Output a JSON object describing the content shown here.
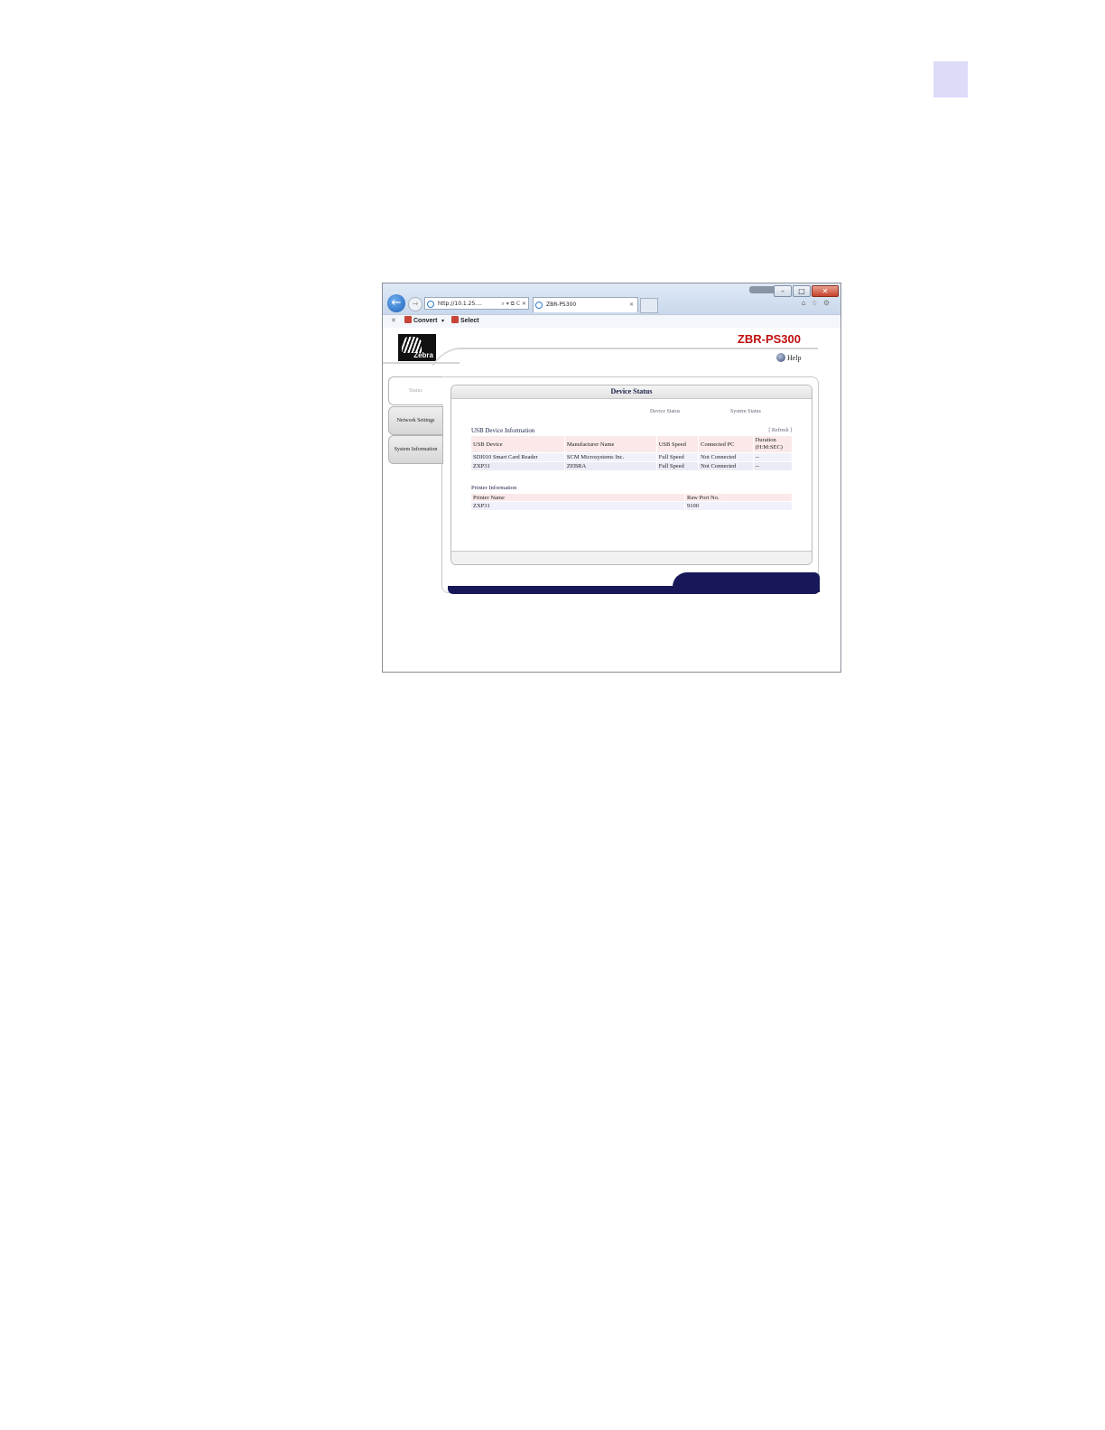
{
  "browser": {
    "address": "http://10.1.25....",
    "address_tools": "⌕ ▾ ⧉ C ✕",
    "tab_title": "ZBR-PS300",
    "tab_close": "✕",
    "back": "←",
    "forward": "→",
    "window_buttons": {
      "minimize": "–",
      "restore": "□",
      "close": "✕"
    },
    "right_icons": "⌂☆⚙",
    "command_bar": {
      "close": "✕",
      "convert": "Convert",
      "arrow": "▾",
      "select": "Select"
    }
  },
  "page": {
    "logo_text": "Zebra",
    "product": "ZBR-PS300",
    "help": "Help",
    "sidebar": [
      "Status",
      "Network Settings",
      "System Information"
    ],
    "panel_title": "Device Status",
    "subnav": [
      "Device Status",
      "System Status"
    ],
    "usb": {
      "title": "USB Device Information",
      "refresh": "[ Refresh ]",
      "headers": [
        "USB Device",
        "Manufacturer Name",
        "USB Speed",
        "Connected PC",
        "Duration (H:M:SEC)"
      ],
      "rows": [
        [
          "SDI010 Smart Card Reader",
          "SCM Microsystems Inc.",
          "Full Speed",
          "Not Connected",
          "--"
        ],
        [
          "ZXP31",
          "ZEBRA",
          "Full Speed",
          "Not Connected",
          "--"
        ]
      ]
    },
    "printer": {
      "title": "Printer Information",
      "headers": [
        "Printer Name",
        "Raw Port No."
      ],
      "rows": [
        [
          "ZXP31",
          "9100"
        ]
      ]
    }
  }
}
